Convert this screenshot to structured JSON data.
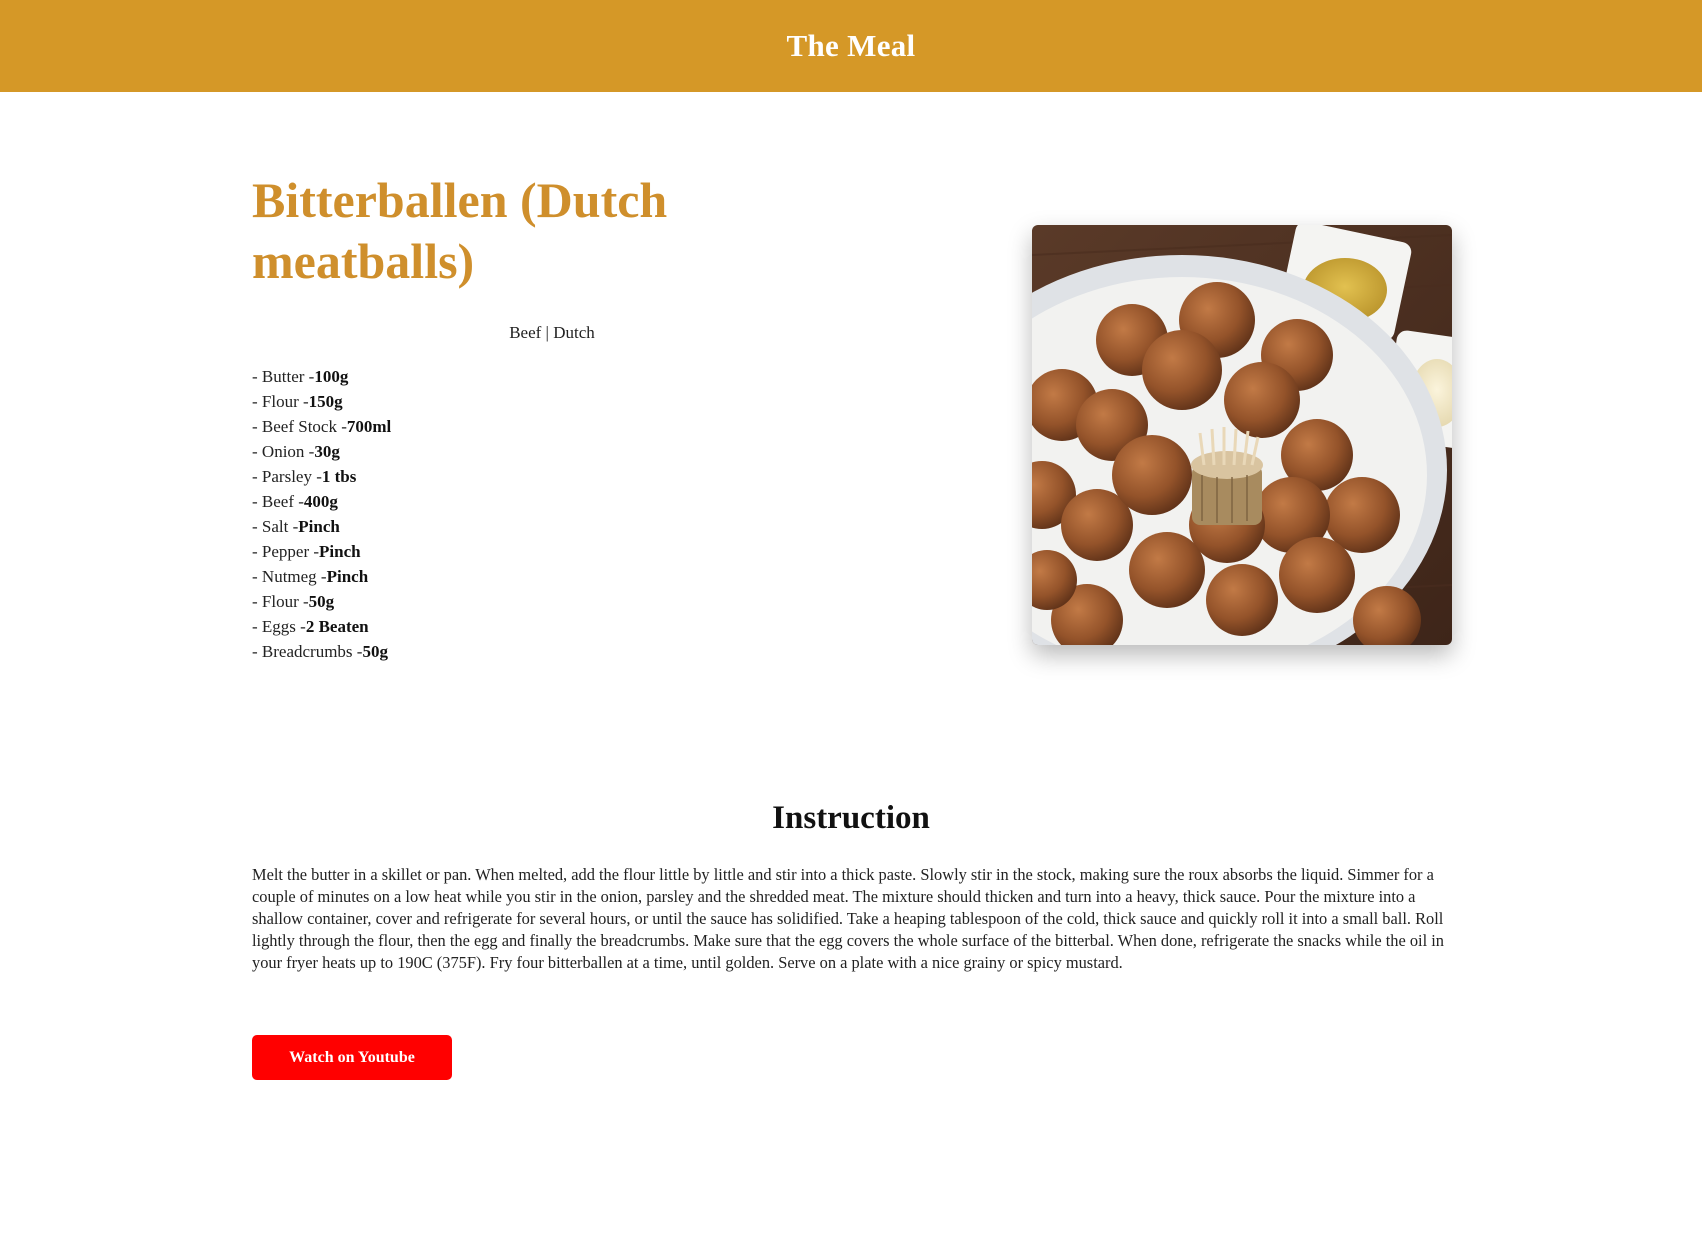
{
  "header": {
    "site_title": "The Meal"
  },
  "recipe": {
    "title": "Bitterballen (Dutch meatballs)",
    "tags": "Beef | Dutch",
    "ingredients": [
      {
        "name": "- Butter -",
        "measure": "100g"
      },
      {
        "name": "- Flour -",
        "measure": "150g"
      },
      {
        "name": "- Beef Stock -",
        "measure": "700ml"
      },
      {
        "name": "- Onion -",
        "measure": "30g"
      },
      {
        "name": "- Parsley -",
        "measure": "1 tbs"
      },
      {
        "name": "- Beef -",
        "measure": "400g"
      },
      {
        "name": "- Salt -",
        "measure": "Pinch"
      },
      {
        "name": "- Pepper -",
        "measure": "Pinch"
      },
      {
        "name": "- Nutmeg -",
        "measure": "Pinch"
      },
      {
        "name": "- Flour -",
        "measure": "50g"
      },
      {
        "name": "- Eggs -",
        "measure": "2 Beaten"
      },
      {
        "name": "- Breadcrumbs -",
        "measure": "50g"
      }
    ],
    "image_icon": "meal-photo"
  },
  "instruction": {
    "heading": "Instruction",
    "text": "Melt the butter in a skillet or pan. When melted, add the flour little by little and stir into a thick paste. Slowly stir in the stock, making sure the roux absorbs the liquid. Simmer for a couple of minutes on a low heat while you stir in the onion, parsley and the shredded meat. The mixture should thicken and turn into a heavy, thick sauce. Pour the mixture into a shallow container, cover and refrigerate for several hours, or until the sauce has solidified. Take a heaping tablespoon of the cold, thick sauce and quickly roll it into a small ball. Roll lightly through the flour, then the egg and finally the breadcrumbs. Make sure that the egg covers the whole surface of the bitterbal. When done, refrigerate the snacks while the oil in your fryer heats up to 190C (375F). Fry four bitterballen at a time, until golden. Serve on a plate with a nice grainy or spicy mustard."
  },
  "youtube": {
    "label": "Watch on Youtube"
  },
  "colors": {
    "header_bg": "#d59827",
    "title_color": "#cf8f2c",
    "youtube_red": "#ff0000"
  }
}
